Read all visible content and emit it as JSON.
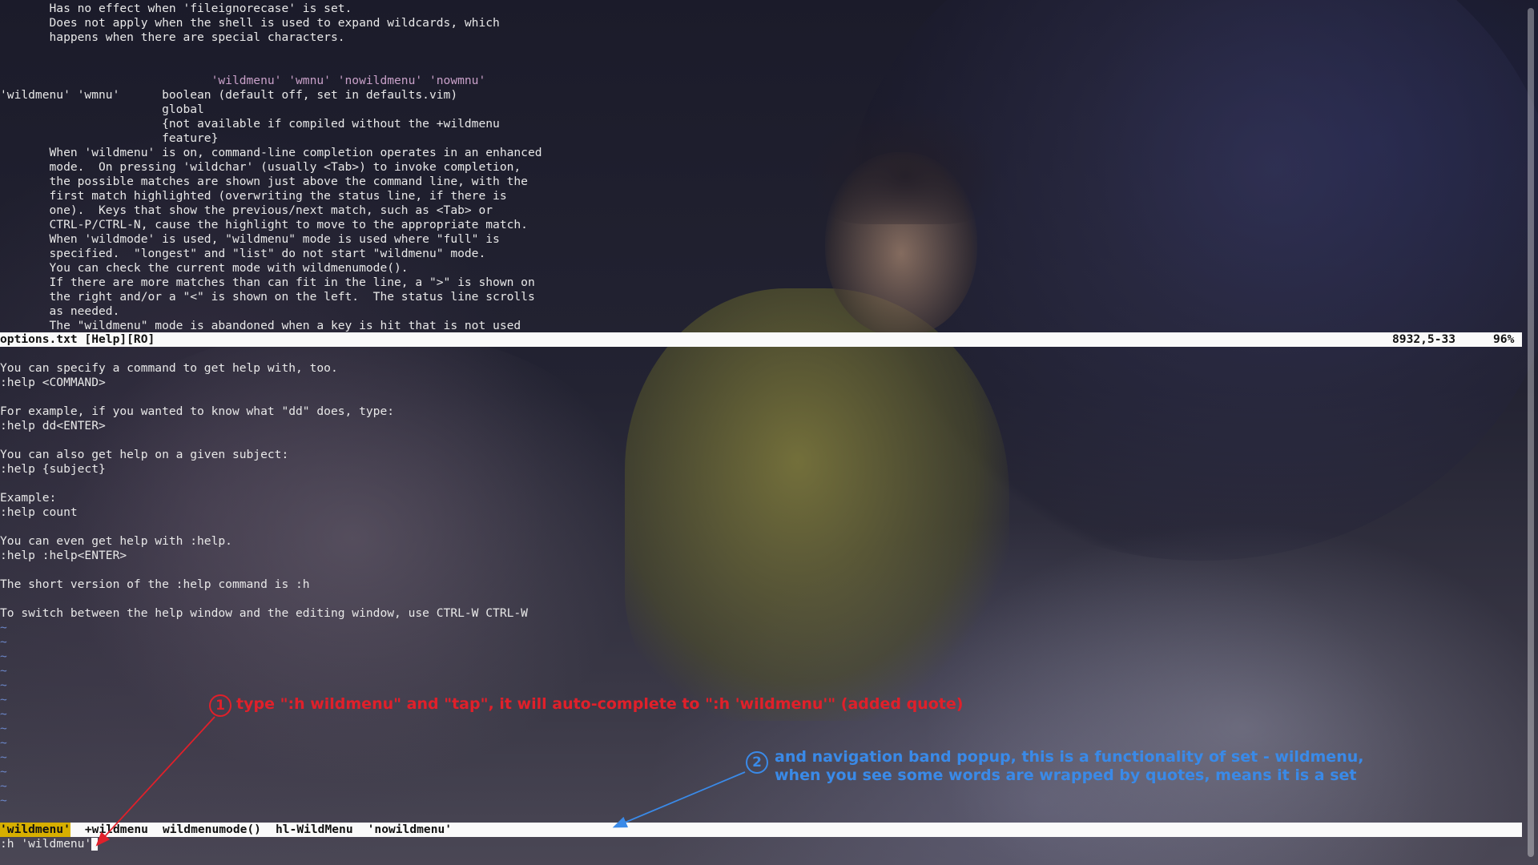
{
  "help_window": {
    "lines": [
      "       Has no effect when 'fileignorecase' is set.",
      "       Does not apply when the shell is used to expand wildcards, which",
      "       happens when there are special characters.",
      "",
      "",
      "                              'wildmenu' 'wmnu' 'nowildmenu' 'nowmnu'",
      "'wildmenu' 'wmnu'      boolean (default off, set in defaults.vim)",
      "                       global",
      "                       {not available if compiled without the +wildmenu",
      "                       feature}",
      "       When 'wildmenu' is on, command-line completion operates in an enhanced",
      "       mode.  On pressing 'wildchar' (usually <Tab>) to invoke completion,",
      "       the possible matches are shown just above the command line, with the",
      "       first match highlighted (overwriting the status line, if there is",
      "       one).  Keys that show the previous/next match, such as <Tab> or",
      "       CTRL-P/CTRL-N, cause the highlight to move to the appropriate match.",
      "       When 'wildmode' is used, \"wildmenu\" mode is used where \"full\" is",
      "       specified.  \"longest\" and \"list\" do not start \"wildmenu\" mode.",
      "       You can check the current mode with wildmenumode().",
      "       If there are more matches than can fit in the line, a \">\" is shown on",
      "       the right and/or a \"<\" is shown on the left.  The status line scrolls",
      "       as needed.",
      "       The \"wildmenu\" mode is abandoned when a key is hit that is not used"
    ],
    "status": {
      "name": "options.txt [Help][RO]",
      "position": "8932,5-33",
      "percent": "96%"
    }
  },
  "edit_window": {
    "lines": [
      "You can specify a command to get help with, too.",
      ":help <COMMAND>",
      "",
      "For example, if you wanted to know what \"dd\" does, type:",
      ":help dd<ENTER>",
      "",
      "You can also get help on a given subject:",
      ":help {subject}",
      "",
      "Example:",
      ":help count",
      "",
      "You can even get help with :help.",
      ":help :help<ENTER>",
      "",
      "The short version of the :help command is :h",
      "",
      "To switch between the help window and the editing window, use CTRL-W CTRL-W"
    ],
    "tilde": "~",
    "tilde_count": 13
  },
  "wildmenu": {
    "items": [
      "'wildmenu'",
      "+wildmenu",
      "wildmenumode()",
      "hl-WildMenu",
      "'nowildmenu'"
    ],
    "selected_index": 0
  },
  "command_line": ":h 'wildmenu'",
  "annotations": {
    "note1": {
      "number": "1",
      "text": "type \":h wildmenu\" and \"tap\", it will auto-complete to \":h 'wildmenu'\" (added quote)",
      "color": "#e0202a"
    },
    "note2": {
      "number": "2",
      "line1": "and navigation band popup, this is a functionality of set - wildmenu,",
      "line2": "when you see some words are wrapped by quotes, means it is a set",
      "color": "#3a8ae8"
    }
  },
  "colors": {
    "status_bg": "#fafafa",
    "wildmenu_selected": "#d7af00",
    "tilde": "#6b86c8",
    "help_tag": "#c8a0c8",
    "option": "#f1a3a3",
    "link": "#5fd7d7"
  }
}
